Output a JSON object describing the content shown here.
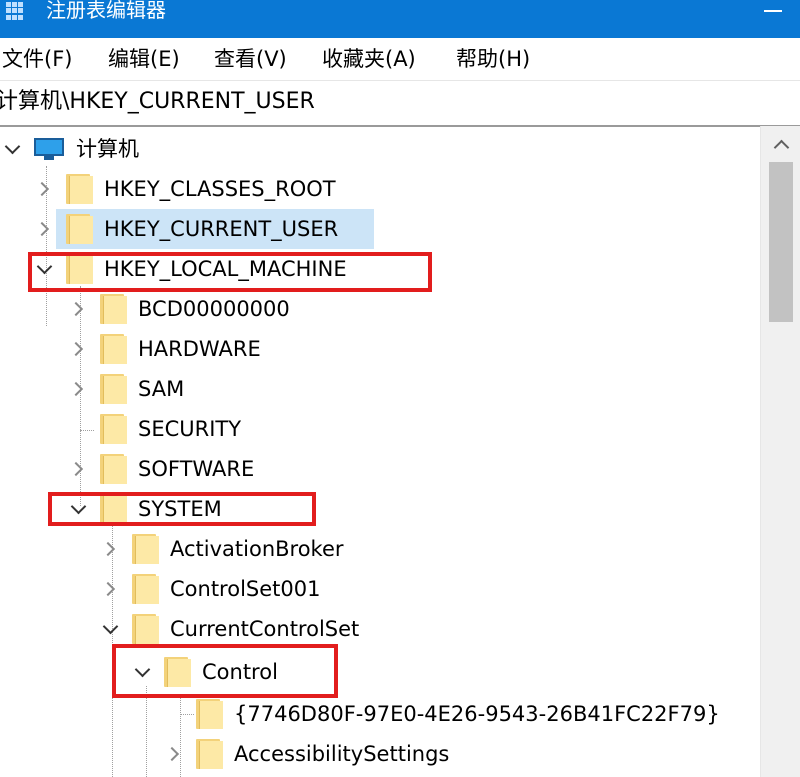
{
  "window": {
    "title": "注册表编辑器",
    "minimize_icon": "minimize-icon"
  },
  "menu": [
    "文件(F)",
    "编辑(E)",
    "查看(V)",
    "收藏夹(A)",
    "帮助(H)"
  ],
  "address": "计算机\\HKEY_CURRENT_USER",
  "tree": {
    "root": "计算机",
    "items": [
      {
        "label": "HKEY_CLASSES_ROOT",
        "state": "collapsed"
      },
      {
        "label": "HKEY_CURRENT_USER",
        "state": "collapsed",
        "selected": true
      },
      {
        "label": "HKEY_LOCAL_MACHINE",
        "state": "expanded",
        "highlighted": true
      },
      {
        "label": "BCD00000000",
        "state": "collapsed"
      },
      {
        "label": "HARDWARE",
        "state": "collapsed"
      },
      {
        "label": "SAM",
        "state": "collapsed"
      },
      {
        "label": "SECURITY",
        "state": "leaf"
      },
      {
        "label": "SOFTWARE",
        "state": "collapsed"
      },
      {
        "label": "SYSTEM",
        "state": "expanded",
        "highlighted": true
      },
      {
        "label": "ActivationBroker",
        "state": "collapsed"
      },
      {
        "label": "ControlSet001",
        "state": "collapsed"
      },
      {
        "label": "CurrentControlSet",
        "state": "expanded"
      },
      {
        "label": "Control",
        "state": "expanded",
        "highlighted": true
      },
      {
        "label": "{7746D80F-97E0-4E26-9543-26B41FC22F79}",
        "state": "leaf"
      },
      {
        "label": "AccessibilitySettings",
        "state": "collapsed"
      }
    ]
  },
  "colors": {
    "titlebar": "#0a78d4",
    "selection": "#cce4f7",
    "highlight_box": "#e21d1d",
    "folder": "#f3d27a"
  }
}
